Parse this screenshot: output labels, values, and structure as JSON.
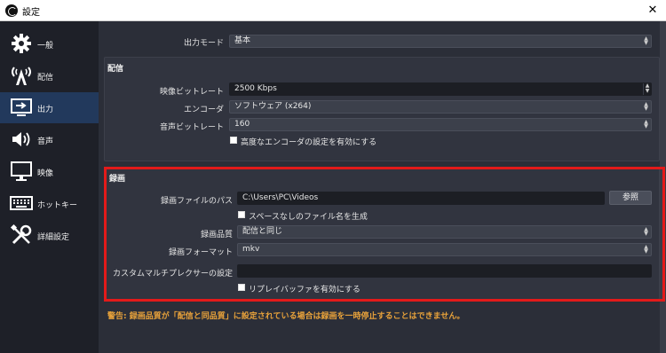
{
  "window": {
    "title": "設定",
    "close_glyph": "✕"
  },
  "sidebar": {
    "items": [
      {
        "label": "一般",
        "icon": "gear-icon",
        "active": false
      },
      {
        "label": "配信",
        "icon": "broadcast-icon",
        "active": false
      },
      {
        "label": "出力",
        "icon": "output-icon",
        "active": true
      },
      {
        "label": "音声",
        "icon": "speaker-icon",
        "active": false
      },
      {
        "label": "映像",
        "icon": "monitor-icon",
        "active": false
      },
      {
        "label": "ホットキー",
        "icon": "keyboard-icon",
        "active": false
      },
      {
        "label": "詳細設定",
        "icon": "tools-icon",
        "active": false
      }
    ]
  },
  "output_mode": {
    "label": "出力モード",
    "value": "基本"
  },
  "streaming": {
    "title": "配信",
    "video_bitrate": {
      "label": "映像ビットレート",
      "value": "2500 Kbps"
    },
    "encoder": {
      "label": "エンコーダ",
      "value": "ソフトウェア (x264)"
    },
    "audio_bitrate": {
      "label": "音声ビットレート",
      "value": "160"
    },
    "advanced_encoder_checkbox": "高度なエンコーダの設定を有効にする"
  },
  "recording": {
    "title": "録画",
    "path": {
      "label": "録画ファイルのパス",
      "value": "C:\\Users\\PC\\Videos",
      "browse_label": "参照"
    },
    "no_space_checkbox": "スペースなしのファイル名を生成",
    "quality": {
      "label": "録画品質",
      "value": "配信と同じ"
    },
    "format": {
      "label": "録画フォーマット",
      "value": "mkv"
    },
    "muxer": {
      "label": "カスタムマルチプレクサーの設定",
      "value": ""
    },
    "replay_buffer_checkbox": "リプレイバッファを有効にする"
  },
  "warning": "警告: 録画品質が「配信と同品質」に設定されている場合は録画を一時停止することはできません。",
  "colors": {
    "highlight": "#e31a1a",
    "warning": "#e8a23a",
    "active_sidebar": "#22395c"
  }
}
